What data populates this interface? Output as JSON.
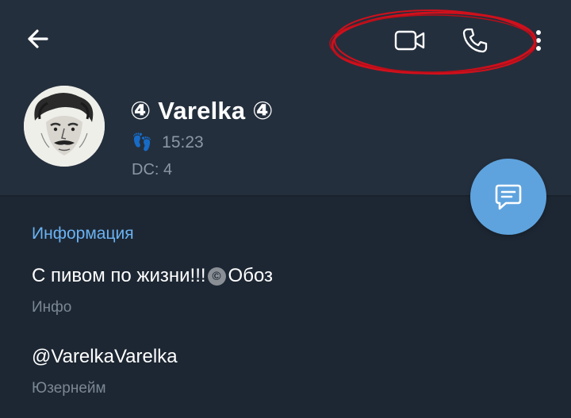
{
  "header": {
    "back_icon": "arrow-left-icon",
    "video_icon": "video-camera-icon",
    "call_icon": "phone-icon",
    "more_icon": "more-vertical-icon",
    "annotation_color": "#d0101c"
  },
  "profile": {
    "name": "④ Varelka ④",
    "status_emoji": "👣",
    "status_time": "15:23",
    "dc": "DC: 4"
  },
  "fab": {
    "icon": "message-icon",
    "color": "#5ea3de"
  },
  "info": {
    "section_title": "Информация",
    "bio_before": "С пивом по жизни!!!",
    "bio_mark": "©",
    "bio_after": "Обоз",
    "bio_label": "Инфо",
    "username": "@VarelkaVarelka",
    "username_label": "Юзернейм"
  },
  "colors": {
    "background": "#1d2733",
    "header_background": "#242f3d",
    "accent": "#6ab3f3",
    "secondary_text": "#7b8794"
  }
}
